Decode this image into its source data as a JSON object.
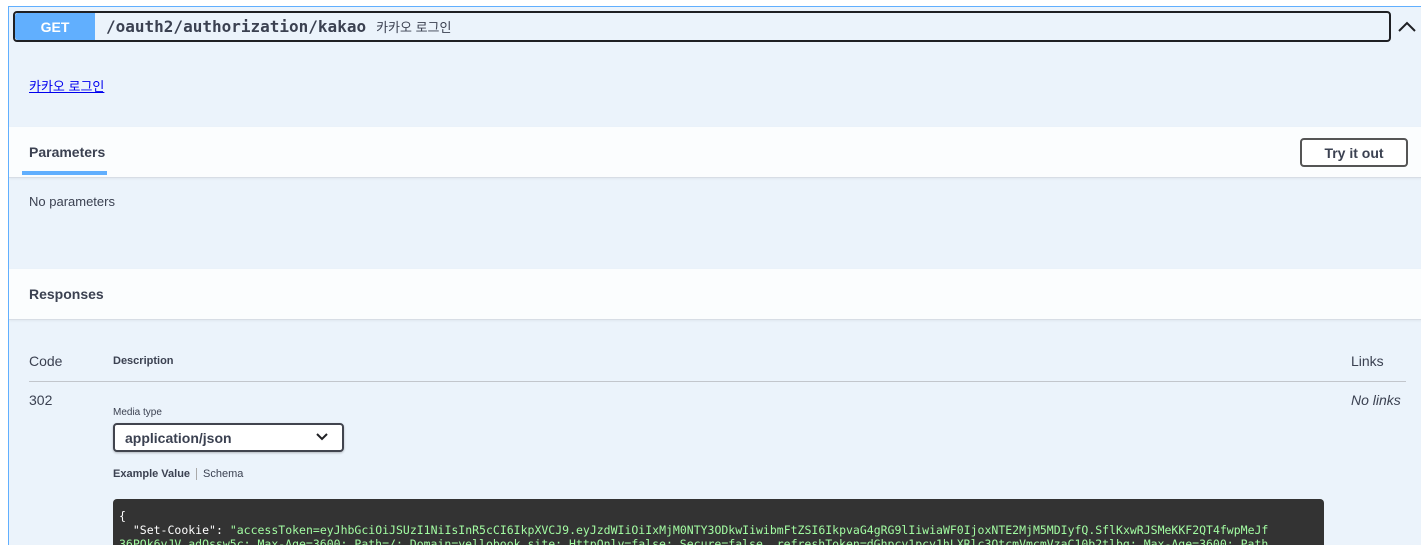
{
  "operation": {
    "method": "GET",
    "path": "/oauth2/authorization/kakao",
    "summary": "카카오 로그인",
    "description_link": "카카오 로그인"
  },
  "parameters": {
    "title": "Parameters",
    "try_button": "Try it out",
    "empty_text": "No parameters"
  },
  "responses": {
    "title": "Responses",
    "columns": {
      "code": "Code",
      "description": "Description",
      "links": "Links"
    },
    "rows": [
      {
        "code": "302",
        "links": "No links",
        "media_type_label": "Media type",
        "media_type_value": "application/json",
        "tab_example": "Example Value",
        "tab_schema": "Schema",
        "example": {
          "open_brace": "{",
          "key": "\"Set-Cookie\"",
          "colon": ": ",
          "value_line1": "\"accessToken=eyJhbGciOiJSUzI1NiIsInR5cCI6IkpXVCJ9.eyJzdWIiOiIxMjM0NTY3ODkwIiwibmFtZSI6IkpvaG4gRG9lIiwiaWF0IjoxNTE2MjM5MDIyfQ.SflKxwRJSMeKKF2QT4fwpMeJf",
          "value_line2": "36POk6yJV_adQssw5c; Max-Age=3600; Path=/; Domain=yellobook.site; HttpOnly=false; Secure=false, refreshToken=dGhpcy1pcy1hLXRlc3QtcmVmcmVzaC10b2tlbg; Max-Age=3600; Path"
        }
      }
    ]
  },
  "colors": {
    "get_accent": "#61affe",
    "panel_bg": "#ebf3fb",
    "code_bg": "#333333",
    "code_string": "#a2fca2"
  },
  "icons": {
    "collapse": "chevron-up-icon",
    "select": "chevron-down-icon"
  }
}
